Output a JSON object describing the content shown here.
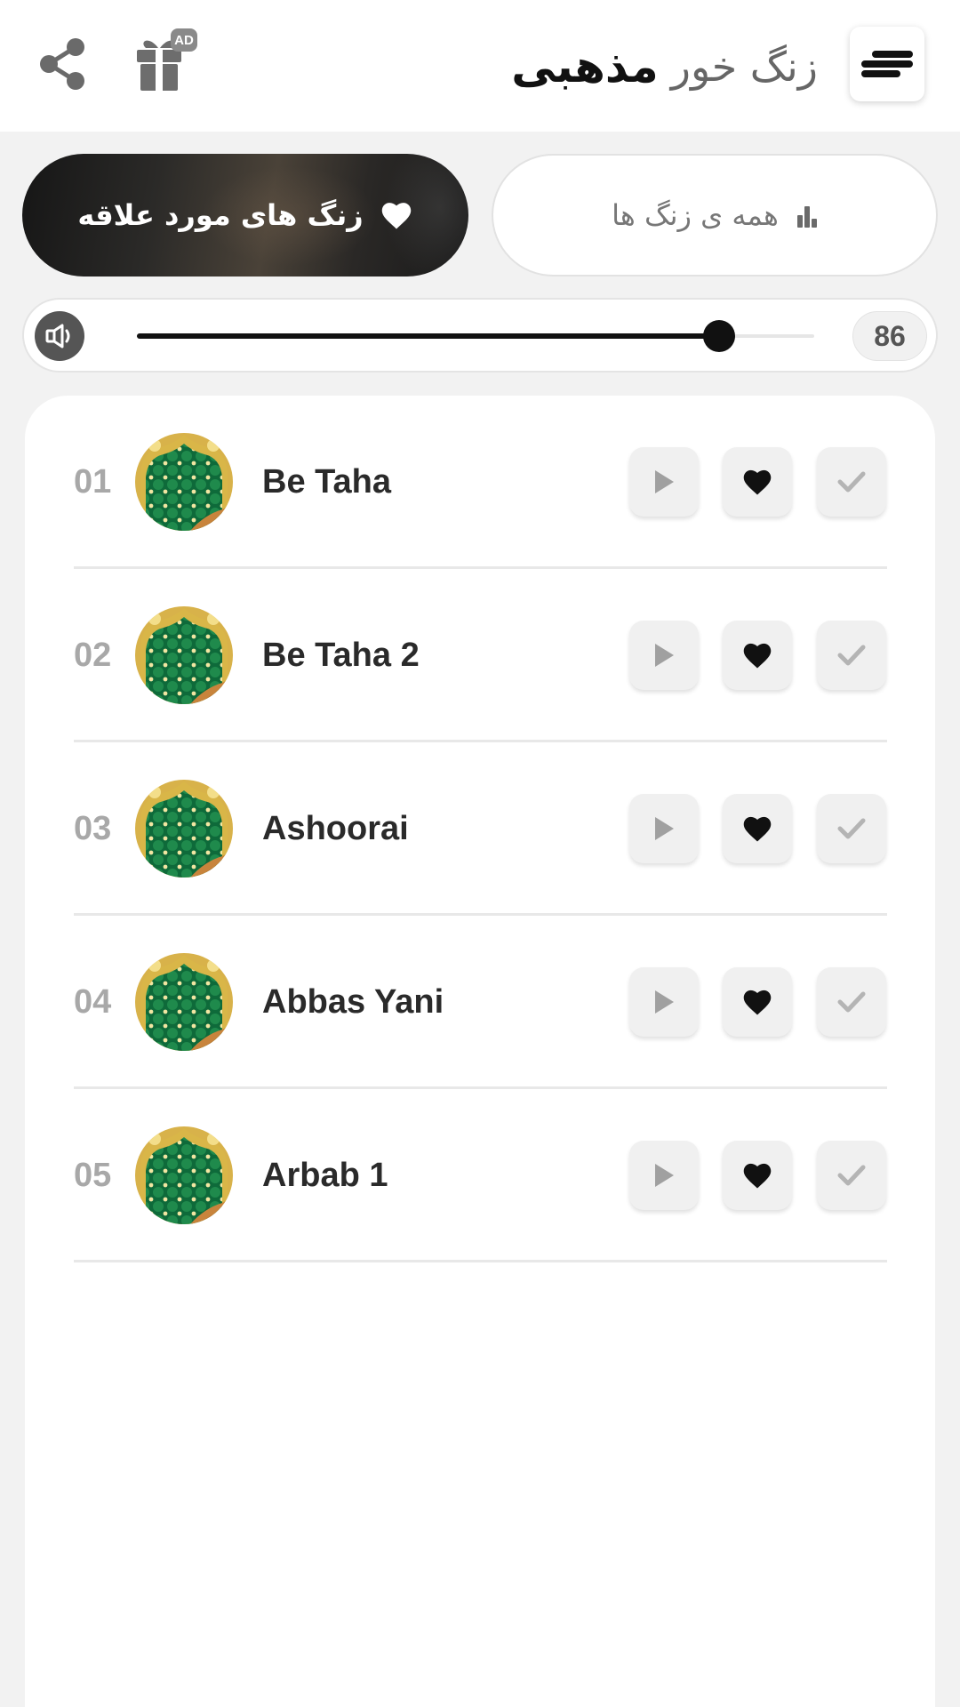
{
  "header": {
    "title_light": "زنگ خور",
    "title_bold": "مذهبی",
    "ad_badge": "AD",
    "icons": {
      "share": "share-icon",
      "gift": "gift-icon",
      "menu": "menu-icon"
    }
  },
  "filters": {
    "favorites_label": "زنگ های مورد علاقه",
    "all_label": "همه ی زنگ ها"
  },
  "volume": {
    "value": "86",
    "level": 0.86
  },
  "ringtones": [
    {
      "num": "01",
      "title": "Be Taha"
    },
    {
      "num": "02",
      "title": "Be Taha 2"
    },
    {
      "num": "03",
      "title": "Ashoorai"
    },
    {
      "num": "04",
      "title": "Abbas Yani"
    },
    {
      "num": "05",
      "title": "Arbab 1"
    }
  ],
  "colors": {
    "accent": "#111111",
    "muted": "#a8a8a8",
    "background": "#f2f2f2"
  }
}
